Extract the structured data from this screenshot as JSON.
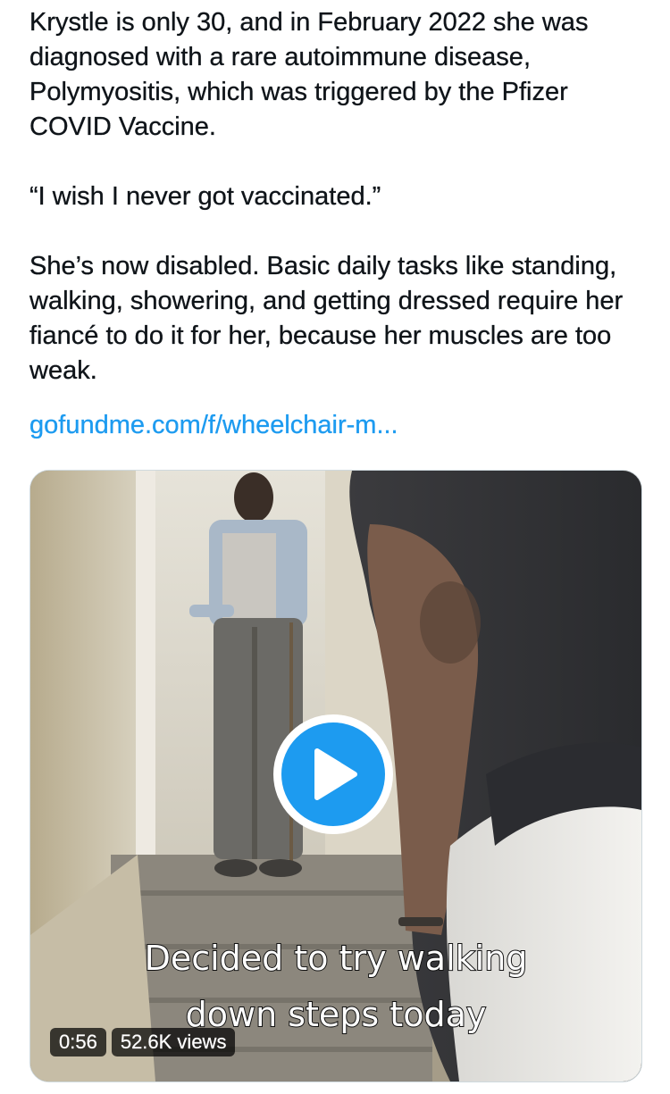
{
  "tweet": {
    "paragraphs": [
      "Krystle is only 30, and in February 2022 she was diagnosed with a rare autoimmune disease, Polymyositis, which was triggered by the Pfizer COVID Vaccine.",
      "“I wish I never got vaccinated.”",
      "She’s now disabled. Basic daily tasks like standing, walking, showering, and getting dressed require her fiancé to do it for her, because her muscles are too weak."
    ],
    "link_text": "gofundme.com/f/wheelchair-m..."
  },
  "video": {
    "caption_line1": "Decided to try walking",
    "caption_line2": "down steps today",
    "duration": "0:56",
    "views": "52.6K views",
    "play_icon": "play-icon"
  },
  "colors": {
    "link": "#1d9bf0",
    "play_button": "#1d9bf0",
    "text": "#0f1419"
  }
}
